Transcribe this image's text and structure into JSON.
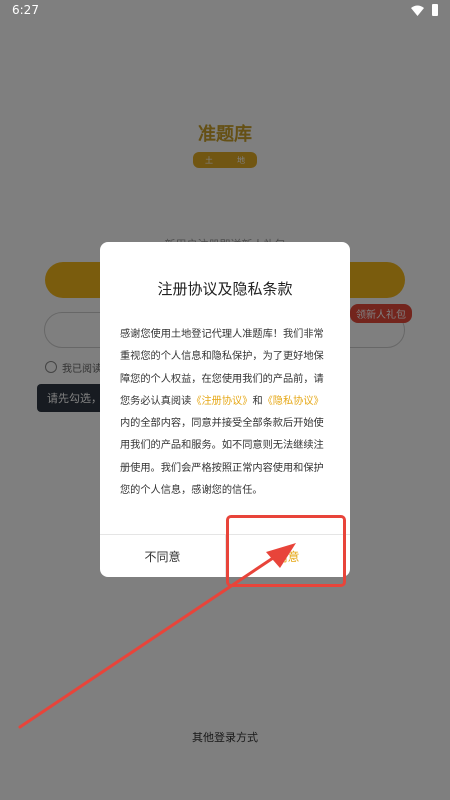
{
  "status_bar": {
    "time": "6:27",
    "wifi_icon": "wifi-icon",
    "battery_icon": "battery-icon"
  },
  "background": {
    "logo_title": "准题库",
    "logo_tag": [
      "土",
      "地"
    ],
    "subtitle": "新用户注册即送新人礼包",
    "gift_badge": "领新人礼包",
    "agree_radio_label": "我已阅读",
    "tip_text": "请先勾选，再",
    "other_login": "其他登录方式"
  },
  "dialog": {
    "title": "注册协议及隐私条款",
    "body_part1": "感谢您使用土地登记代理人准题库！我们非常重视您的个人信息和隐私保护，为了更好地保障您的个人权益，在您使用我们的产品前，请您务必认真阅读",
    "link_register": "《注册协议》",
    "and_text": "和",
    "link_privacy": "《隐私协议》",
    "body_part2": "内的全部内容，同意并接受全部条款后开始使用我们的产品和服务。如不同意则无法继续注册使用。我们会严格按照正常内容使用和保护您的个人信息，感谢您的信任。",
    "disagree_label": "不同意",
    "agree_label": "同意"
  },
  "colors": {
    "accent": "#e6a817",
    "annotation": "#e8443a",
    "overlay": "rgba(0,0,0,0.5)"
  }
}
